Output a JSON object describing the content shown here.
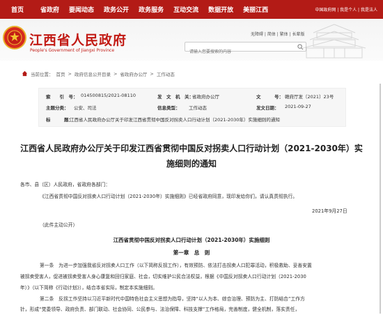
{
  "nav": {
    "items": [
      "首页",
      "省政府",
      "要闻动态",
      "政务公开",
      "政务服务",
      "互动交流",
      "数据开放",
      "美丽江西"
    ],
    "right": "中国政府网 | 我是个人 | 我是法人"
  },
  "header": {
    "title": "江西省人民政府",
    "subtitle": "People's Government of Jiangxi Province",
    "links": "无障碍 | 简体 | 繁体 | 长辈版",
    "search_placeholder": "请输入您要搜索的内容"
  },
  "breadcrumb": {
    "label": "当前位置：",
    "items": [
      "首页",
      "政府信息公开目录",
      "省政府办公厅",
      "工作动态"
    ],
    "separator": ">"
  },
  "meta": {
    "index_label": "索　　引　号：",
    "index_value": "014500815/2021-08110",
    "org_label": "发　文　机　关：",
    "org_value": "省政府办公厅",
    "doc_label": "文　　　号：",
    "doc_value": "赣府厅发〔2021〕23号",
    "topic_label": "主题分类：",
    "topic_value": "公安、司法",
    "type_label": "信息类型：",
    "type_value": "工作动态",
    "date_label": "发文日期：",
    "date_value": "2021-09-27",
    "title_label": "标　　　题：",
    "title_value": "江西省人民政府办公厅关于印发江西省贯彻中国反对拐卖人口行动计划（2021-2030年）实施细则的通知"
  },
  "article": {
    "title": "江西省人民政府办公厅关于印发江西省贯彻中国反对拐卖人口行动计划（2021-2030年）实施细则的通知",
    "salutation": "各市、县（区）人民政府，省政府各部门：",
    "intro": "《江西省贯彻中国反对拐卖人口行动计划（2021-2030年）实施细则》已经省政府同意，现印发给你们，请认真贯彻执行。",
    "date": "2021年9月27日",
    "note": "（此件主动公开）",
    "sub_title": "江西省贯彻中国反对拐卖人口行动计划（2021-2030年）实施细则",
    "chapter": "第一章　总　则",
    "para1_l1": "第一条　为进一步加强我省反对拐卖人口工作（以下简称反拐工作），有效预防、依法打击拐卖人口犯罪活动，积极救助、妥善安置",
    "para1_l2": "被拐卖受害人，促进被拐卖受害人身心康复和回归家庭、社会，切实维护公民合法权益，根据《中国反对拐卖人口行动计划（2021-2030",
    "para1_l3": "年）》（以下简称《行动计划》），结合本省实际，制定本实施细则。",
    "para2_l1": "第二条　反拐工作坚持以习近平新时代中国特色社会主义思想为指导，坚持“以人为本、综合治理、预防为主、打防结合”工作方",
    "para2_l2": "针，形成“党委领导、政府负责、部门联动、社会协同、公民参与、法治保障、科技支撑”工作格局，完善制度，健全机制，落实责任，"
  },
  "colors": {
    "brand_red": "#b31b16",
    "title_red": "#c21a14"
  }
}
